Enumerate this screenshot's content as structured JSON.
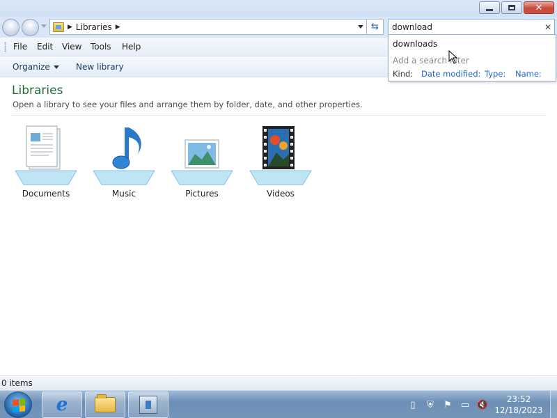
{
  "window": {
    "buttons": {
      "minimize": "minimize",
      "maximize": "restore",
      "close": "close"
    }
  },
  "address": {
    "path": "Libraries"
  },
  "search": {
    "value": "download"
  },
  "menu": {
    "file": "File",
    "edit": "Edit",
    "view": "View",
    "tools": "Tools",
    "help": "Help"
  },
  "toolbar": {
    "organize": "Organize",
    "new_library": "New library"
  },
  "libraries": {
    "title": "Libraries",
    "subtitle": "Open a library to see your files and arrange them by folder, date, and other properties.",
    "items": [
      {
        "label": "Documents",
        "icon": "documents-library-icon"
      },
      {
        "label": "Music",
        "icon": "music-library-icon"
      },
      {
        "label": "Pictures",
        "icon": "pictures-library-icon"
      },
      {
        "label": "Videos",
        "icon": "videos-library-icon"
      }
    ]
  },
  "suggestions": {
    "item": "downloads",
    "hint": "Add a search filter",
    "filters": {
      "kind": "Kind:",
      "date": "Date modified:",
      "type": "Type:",
      "name": "Name:"
    }
  },
  "status": {
    "items": "0 items"
  },
  "taskbar": {
    "time": "23:52",
    "date": "12/18/2023"
  }
}
